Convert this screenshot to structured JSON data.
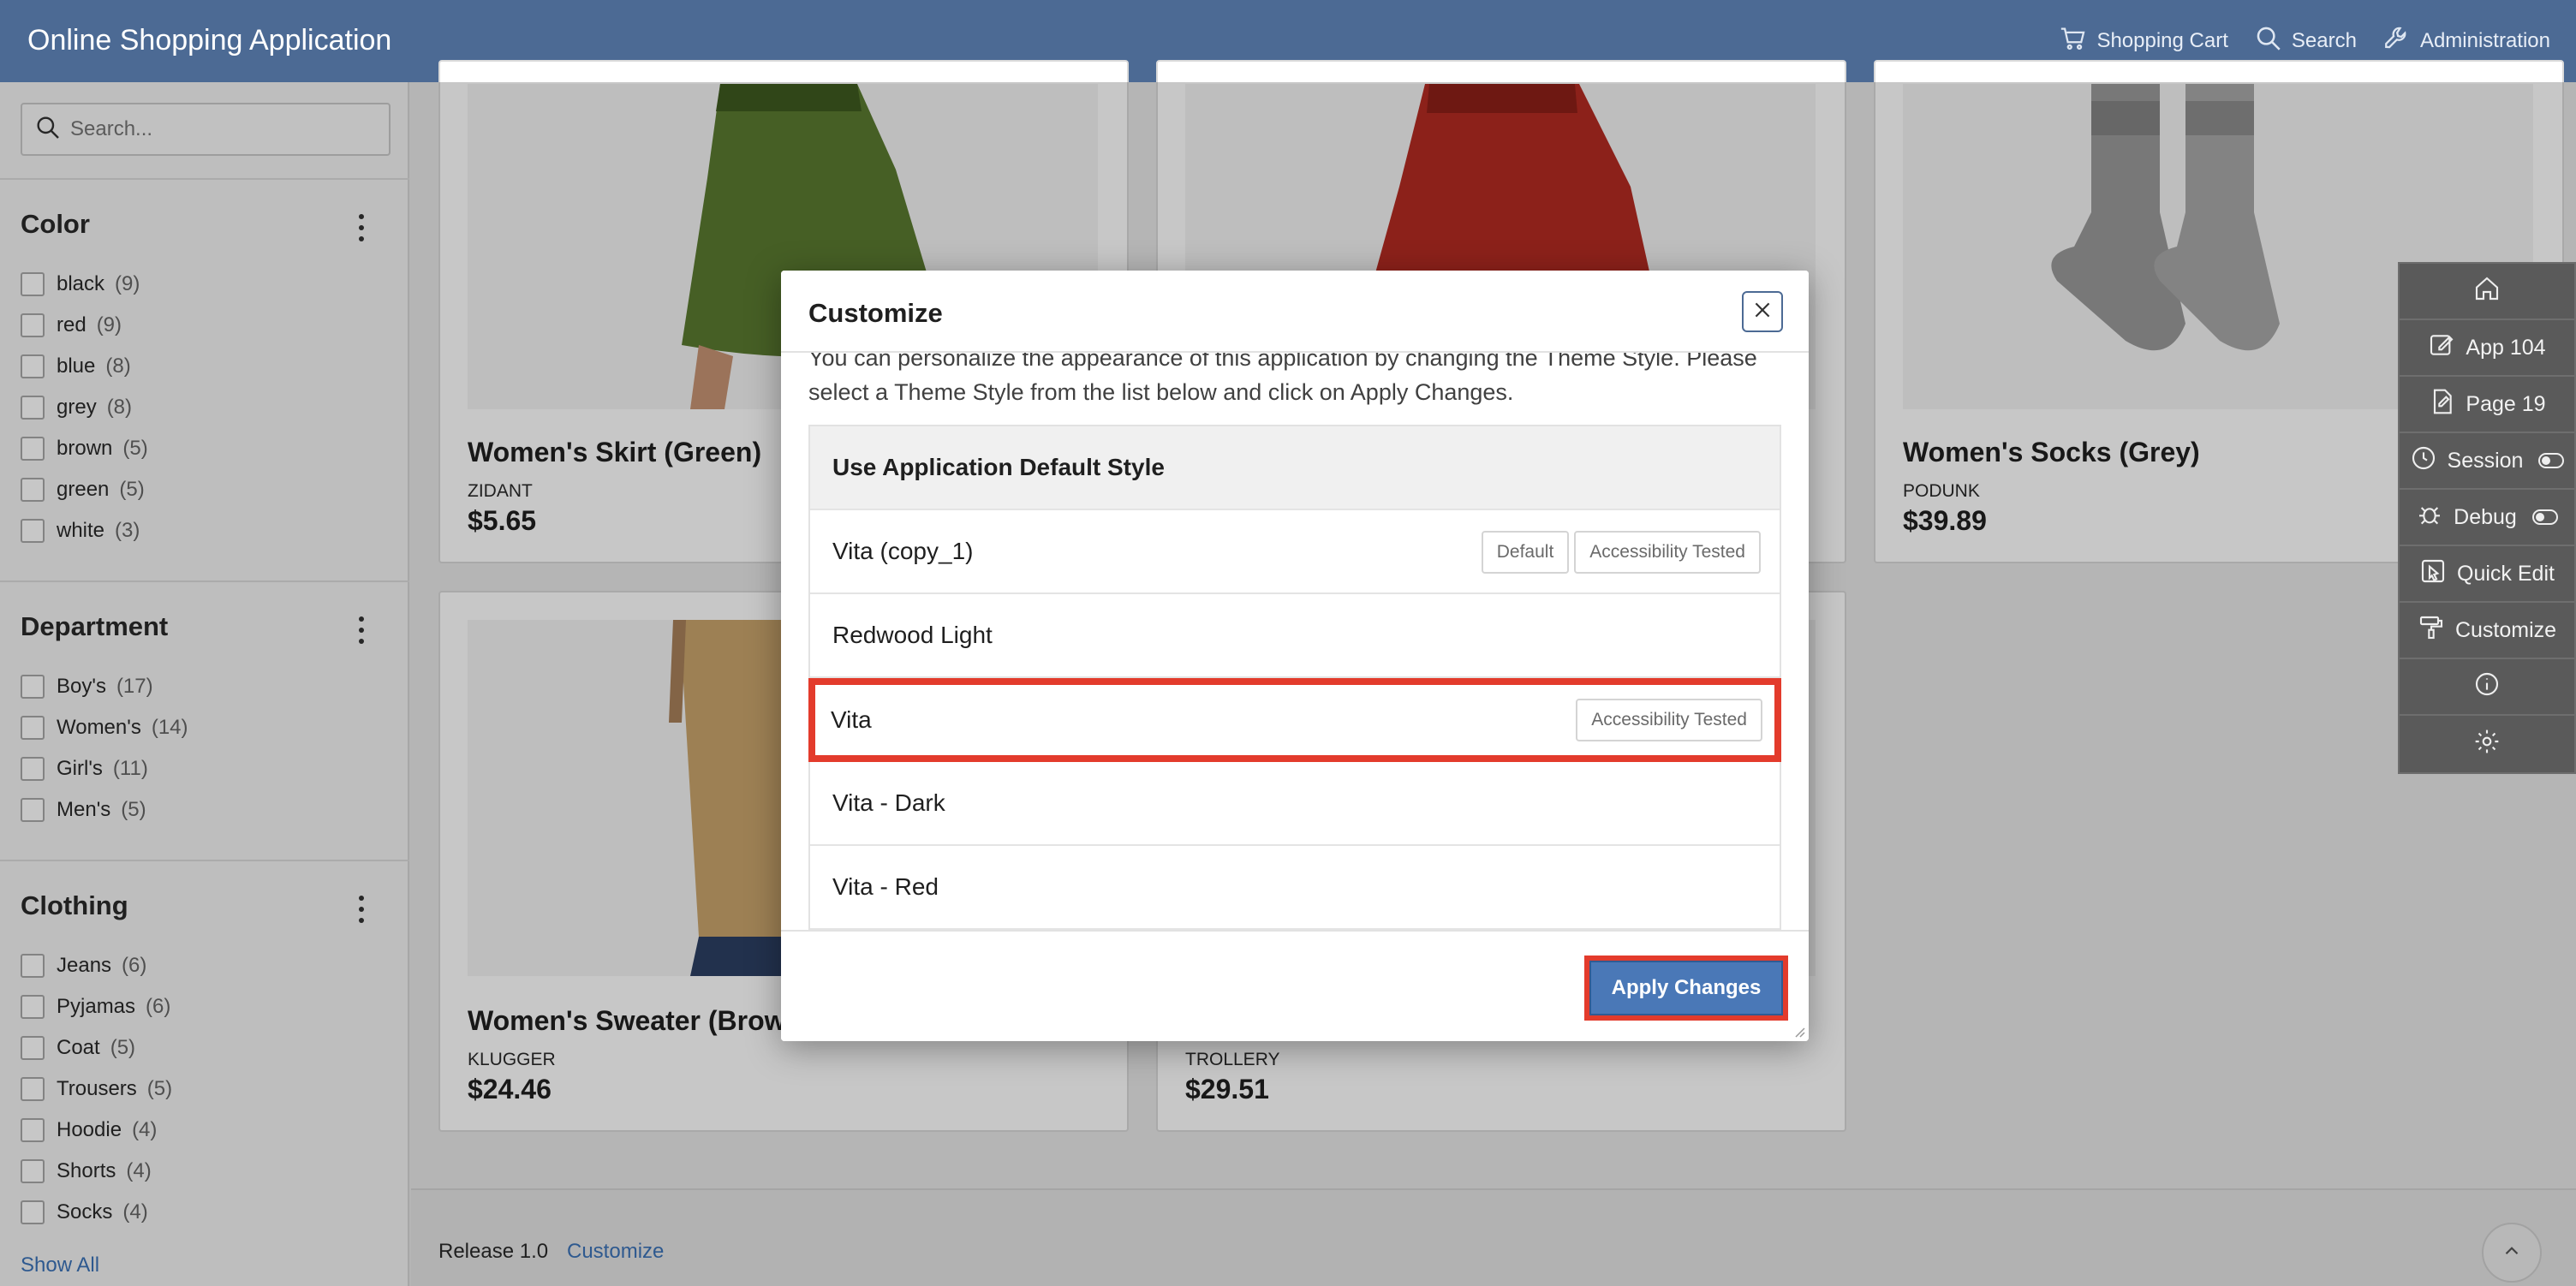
{
  "header": {
    "title": "Online Shopping Application",
    "nav": [
      {
        "label": "Shopping Cart",
        "icon": "cart-icon"
      },
      {
        "label": "Search",
        "icon": "search-icon"
      },
      {
        "label": "Administration",
        "icon": "wrench-icon"
      }
    ]
  },
  "sidebar": {
    "search_placeholder": "Search...",
    "facets": [
      {
        "title": "Color",
        "options": [
          {
            "label": "black",
            "count": "(9)"
          },
          {
            "label": "red",
            "count": "(9)"
          },
          {
            "label": "blue",
            "count": "(8)"
          },
          {
            "label": "grey",
            "count": "(8)"
          },
          {
            "label": "brown",
            "count": "(5)"
          },
          {
            "label": "green",
            "count": "(5)"
          },
          {
            "label": "white",
            "count": "(3)"
          }
        ]
      },
      {
        "title": "Department",
        "options": [
          {
            "label": "Boy's",
            "count": "(17)"
          },
          {
            "label": "Women's",
            "count": "(14)"
          },
          {
            "label": "Girl's",
            "count": "(11)"
          },
          {
            "label": "Men's",
            "count": "(5)"
          }
        ]
      },
      {
        "title": "Clothing",
        "options": [
          {
            "label": "Jeans",
            "count": "(6)"
          },
          {
            "label": "Pyjamas",
            "count": "(6)"
          },
          {
            "label": "Coat",
            "count": "(5)"
          },
          {
            "label": "Trousers",
            "count": "(5)"
          },
          {
            "label": "Hoodie",
            "count": "(4)"
          },
          {
            "label": "Shorts",
            "count": "(4)"
          },
          {
            "label": "Socks",
            "count": "(4)"
          }
        ]
      }
    ],
    "show_all": "Show All"
  },
  "products": [
    {
      "name": "Women's Skirt (Green)",
      "brand": "ZIDANT",
      "price": "$5.65"
    },
    {
      "name": "",
      "brand": "",
      "price": ""
    },
    {
      "name": "Women's Socks (Grey)",
      "brand": "PODUNK",
      "price": "$39.89"
    },
    {
      "name": "Women's Sweater (Brow",
      "brand": "KLUGGER",
      "price": "$24.46"
    },
    {
      "name": "",
      "brand": "TROLLERY",
      "price": "$29.51"
    }
  ],
  "footer": {
    "release": "Release 1.0",
    "customize_link": "Customize"
  },
  "devbar": {
    "items": [
      {
        "label": "",
        "icon": "home-icon"
      },
      {
        "label": "App 104",
        "icon": "edit-icon"
      },
      {
        "label": "Page 19",
        "icon": "page-icon"
      },
      {
        "label": "Session",
        "icon": "session-icon"
      },
      {
        "label": "Debug",
        "icon": "debug-icon"
      },
      {
        "label": "Quick Edit",
        "icon": "quick-edit-icon"
      },
      {
        "label": "Customize",
        "icon": "paint-roller-icon"
      },
      {
        "label": "",
        "icon": "info-icon"
      },
      {
        "label": "",
        "icon": "gear-icon"
      }
    ]
  },
  "dialog": {
    "title": "Customize",
    "description": "You can personalize the appearance of this application by changing the Theme Style. Please select a Theme Style from the list below and click on Apply Changes.",
    "styles": [
      {
        "label": "Use Application Default Style",
        "badges": []
      },
      {
        "label": "Vita (copy_1)",
        "badges": [
          "Default",
          "Accessibility Tested"
        ]
      },
      {
        "label": "Redwood Light",
        "badges": []
      },
      {
        "label": "Vita",
        "badges": [
          "Accessibility Tested"
        ],
        "selected": true
      },
      {
        "label": "Vita - Dark",
        "badges": []
      },
      {
        "label": "Vita - Red",
        "badges": []
      }
    ],
    "apply_label": "Apply Changes"
  },
  "colors": {
    "header_bg": "#4c6a94",
    "accent_red": "#e33b2c",
    "button_blue": "#4a78b7",
    "devbar_bg": "#5a5a5a"
  }
}
